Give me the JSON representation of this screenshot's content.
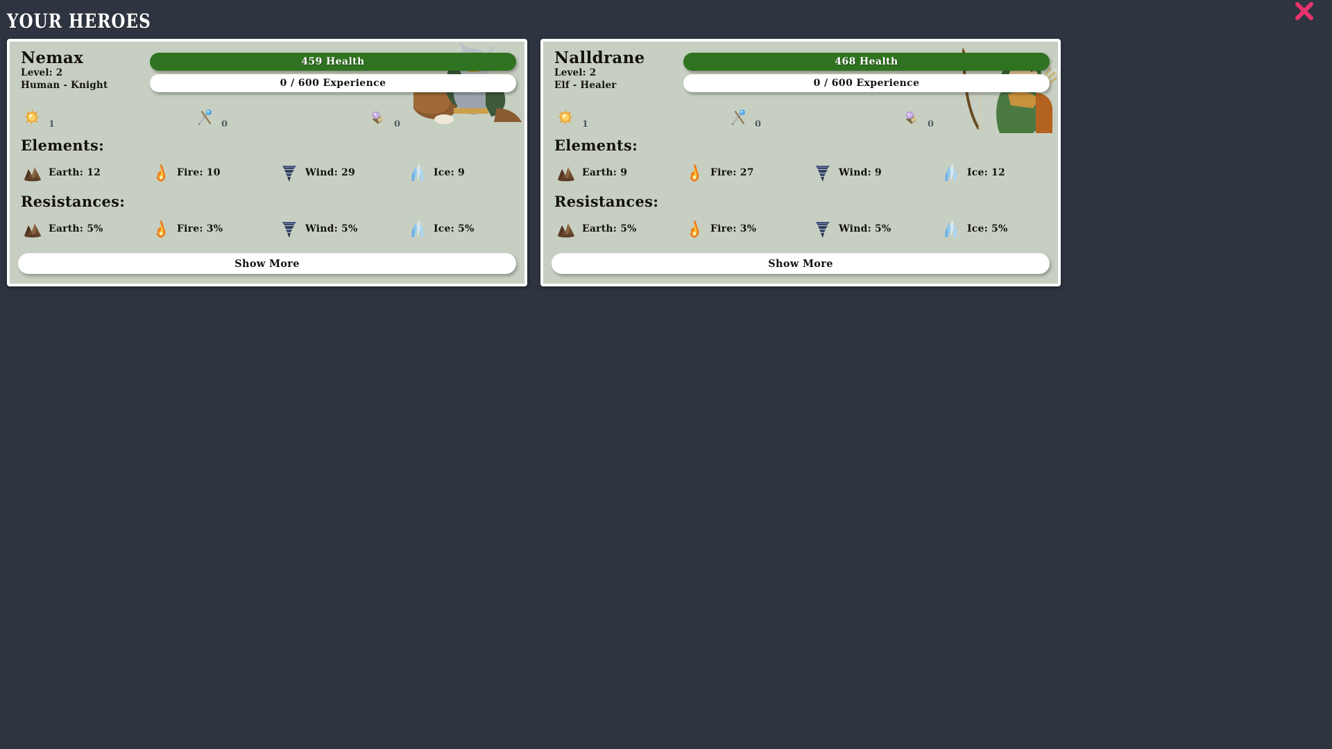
{
  "header": {
    "title": "Your Heroes",
    "close_label": "close-button"
  },
  "colors": {
    "background": "#2e3440",
    "card_background": "#c7cfc2",
    "card_border": "#ffffff",
    "health_bar": "#2f7320",
    "experience_bar": "#ffffff",
    "close_icon": "#e8336d",
    "text_dark": "#14110d",
    "resource_value": "#4e5a5c"
  },
  "labels": {
    "elements_heading": "Elements:",
    "resistances_heading": "Resistances:",
    "show_more": "Show More"
  },
  "heroes": [
    {
      "name": "Nemax",
      "level": "Level: 2",
      "race_class": "Human - Knight",
      "health": "459 Health",
      "experience": "0 / 600 Experience",
      "health_percent": 100,
      "experience_percent": 0,
      "portrait": "knight-on-horse",
      "resources": [
        {
          "icon": "gold-orb-icon",
          "value": "1"
        },
        {
          "icon": "crossed-weapons-icon",
          "value": "0"
        },
        {
          "icon": "purple-gem-book-icon",
          "value": "0"
        }
      ],
      "elements": [
        {
          "icon": "earth-icon",
          "label": "Earth: 12"
        },
        {
          "icon": "fire-icon",
          "label": "Fire: 10"
        },
        {
          "icon": "wind-icon",
          "label": "Wind: 29"
        },
        {
          "icon": "ice-icon",
          "label": "Ice: 9"
        }
      ],
      "resistances": [
        {
          "icon": "earth-icon",
          "label": "Earth: 5%"
        },
        {
          "icon": "fire-icon",
          "label": "Fire: 3%"
        },
        {
          "icon": "wind-icon",
          "label": "Wind: 5%"
        },
        {
          "icon": "ice-icon",
          "label": "Ice: 5%"
        }
      ],
      "show_more": "Show More"
    },
    {
      "name": "Nalldrane",
      "level": "Level: 2",
      "race_class": "Elf - Healer",
      "health": "468 Health",
      "experience": "0 / 600 Experience",
      "health_percent": 100,
      "experience_percent": 0,
      "portrait": "elf-archer",
      "resources": [
        {
          "icon": "gold-orb-icon",
          "value": "1"
        },
        {
          "icon": "crossed-weapons-icon",
          "value": "0"
        },
        {
          "icon": "purple-gem-book-icon",
          "value": "0"
        }
      ],
      "elements": [
        {
          "icon": "earth-icon",
          "label": "Earth: 9"
        },
        {
          "icon": "fire-icon",
          "label": "Fire: 27"
        },
        {
          "icon": "wind-icon",
          "label": "Wind: 9"
        },
        {
          "icon": "ice-icon",
          "label": "Ice: 12"
        }
      ],
      "resistances": [
        {
          "icon": "earth-icon",
          "label": "Earth: 5%"
        },
        {
          "icon": "fire-icon",
          "label": "Fire: 3%"
        },
        {
          "icon": "wind-icon",
          "label": "Wind: 5%"
        },
        {
          "icon": "ice-icon",
          "label": "Ice: 5%"
        }
      ],
      "show_more": "Show More"
    }
  ]
}
